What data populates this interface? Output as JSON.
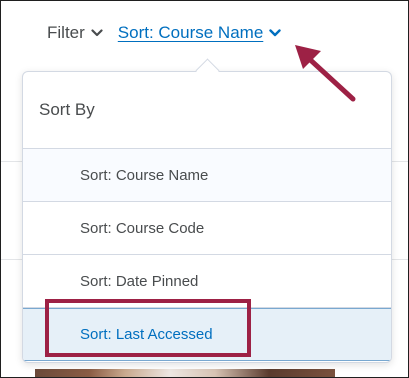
{
  "toolbar": {
    "filter_label": "Filter",
    "sort_label": "Sort: Course Name"
  },
  "dropdown": {
    "header": "Sort By",
    "items": [
      {
        "label": "Sort: Course Name",
        "state": "hover"
      },
      {
        "label": "Sort: Course Code",
        "state": "normal"
      },
      {
        "label": "Sort: Date Pinned",
        "state": "normal"
      },
      {
        "label": "Sort: Last Accessed",
        "state": "selected"
      }
    ]
  },
  "colors": {
    "link": "#006fbf",
    "text": "#494c4e",
    "selected_bg": "#e6f0f8",
    "annotation": "#9d2145"
  },
  "icons": {
    "filter_chevron": "chevron-down-icon",
    "sort_chevron": "chevron-down-icon",
    "annotation_arrow": "arrow-icon"
  }
}
